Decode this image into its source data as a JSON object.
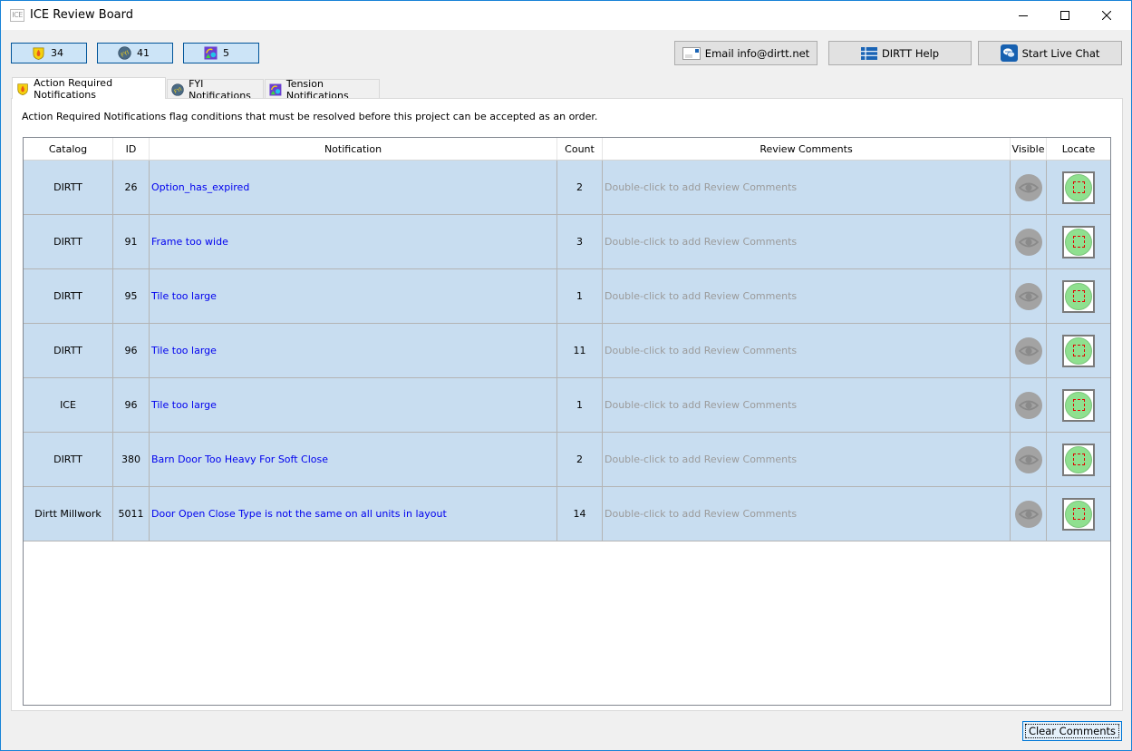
{
  "window": {
    "title": "ICE Review Board",
    "app_icon_text": "ICE",
    "controls": [
      "minimize",
      "maximize",
      "close"
    ]
  },
  "counters": [
    {
      "icon": "action-required-shield-icon",
      "value": "34"
    },
    {
      "icon": "fyi-globe-icon",
      "value": "41"
    },
    {
      "icon": "tension-shapes-icon",
      "value": "5"
    }
  ],
  "toolbar": {
    "email_label": "Email info@dirtt.net",
    "help_label": "DIRTT Help",
    "chat_label": "Start Live Chat"
  },
  "tabs": [
    {
      "label": "Action Required Notifications",
      "icon": "action-required-shield-icon",
      "active": true
    },
    {
      "label": "FYI Notifications",
      "icon": "fyi-globe-icon",
      "active": false
    },
    {
      "label": "Tension Notifications",
      "icon": "tension-shapes-icon",
      "active": false
    }
  ],
  "description": "Action Required Notifications flag conditions that must be resolved before this project can be accepted as an order.",
  "table": {
    "columns": [
      "Catalog",
      "ID",
      "Notification",
      "Count",
      "Review Comments",
      "Visible",
      "Locate"
    ],
    "comment_placeholder": "Double-click to add Review Comments",
    "rows": [
      {
        "catalog": "DIRTT",
        "id": "26",
        "notification": "Option_has_expired",
        "count": "2",
        "comment": "Double-click to add Review Comments"
      },
      {
        "catalog": "DIRTT",
        "id": "91",
        "notification": "Frame too wide",
        "count": "3",
        "comment": "Double-click to add Review Comments"
      },
      {
        "catalog": "DIRTT",
        "id": "95",
        "notification": "Tile too large",
        "count": "1",
        "comment": "Double-click to add Review Comments"
      },
      {
        "catalog": "DIRTT",
        "id": "96",
        "notification": "Tile too large",
        "count": "11",
        "comment": "Double-click to add Review Comments"
      },
      {
        "catalog": "ICE",
        "id": "96",
        "notification": "Tile too large",
        "count": "1",
        "comment": "Double-click to add Review Comments"
      },
      {
        "catalog": "DIRTT",
        "id": "380",
        "notification": "Barn Door Too Heavy For Soft Close",
        "count": "2",
        "comment": "Double-click to add Review Comments"
      },
      {
        "catalog": "Dirtt Millwork",
        "id": "5011",
        "notification": "Door Open Close Type is not the same on all units in layout",
        "count": "14",
        "comment": "Double-click to add Review Comments"
      }
    ]
  },
  "footer": {
    "clear_label": "Clear Comments"
  },
  "colors": {
    "selected_row": "#c8ddf0",
    "link_text": "#0000ee",
    "placeholder_text": "#9b9b9b",
    "counter_bg": "#cce4f7",
    "counter_border": "#005499"
  }
}
